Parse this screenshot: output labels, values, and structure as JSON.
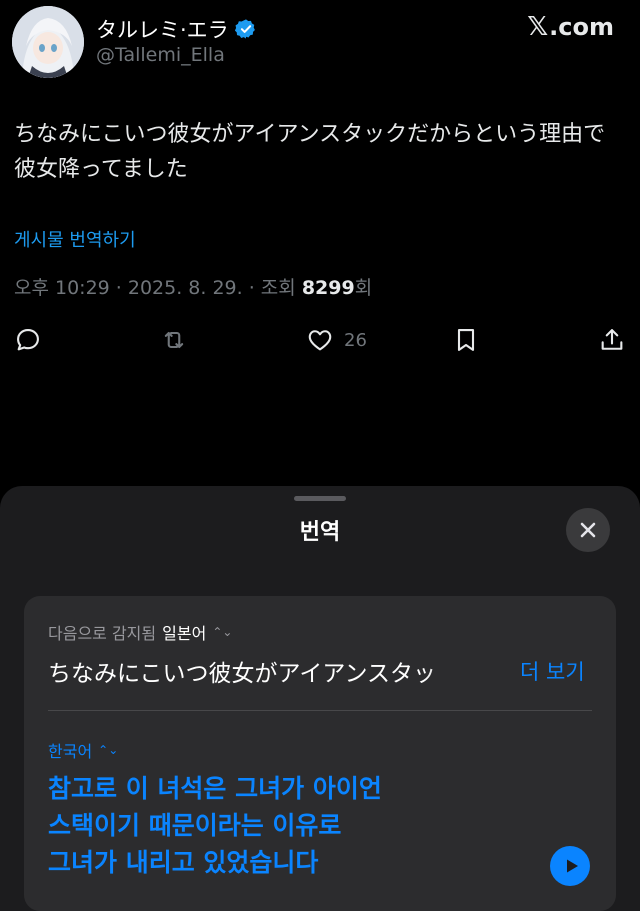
{
  "tweet": {
    "display_name": "タルレミ·エラ",
    "verified": true,
    "handle": "@Tallemi_Ella",
    "watermark": "X.com",
    "watermark_x": "𝕏",
    "watermark_rest": ".com",
    "text": "ちなみにこいつ彼女がアイアンスタックだからという理由で彼女降ってました",
    "translate_link": "게시물 번역하기",
    "meta_prefix": "오후 10:29 · 2025. 8. 29. · 조회 ",
    "views": "8299",
    "meta_suffix": "회",
    "actions": {
      "reply_icon": "reply-icon",
      "retweet_icon": "retweet-icon",
      "like_icon": "heart-icon",
      "like_count": "26",
      "bookmark_icon": "bookmark-icon",
      "share_icon": "share-icon"
    }
  },
  "translate_sheet": {
    "title": "번역",
    "close_icon": "close-icon",
    "source": {
      "label_prefix": "다음으로 감지됨",
      "language": "일본어",
      "text": "ちなみにこいつ彼女がアイアンスタッ",
      "more_label": "더 보기"
    },
    "target": {
      "language": "한국어",
      "text_line1": "참고로 이 녀석은 그녀가 아이언",
      "text_line2": "스택이기 때문이라는 이유로",
      "text_line3": "그녀가 내리고 있었습니다"
    },
    "play_icon": "play-icon"
  },
  "colors": {
    "background": "#000000",
    "sheet": "#1c1c1e",
    "card": "#2c2c2e",
    "accent_x": "#1d9bf0",
    "accent_ios": "#0a84ff",
    "muted": "#71767b"
  }
}
